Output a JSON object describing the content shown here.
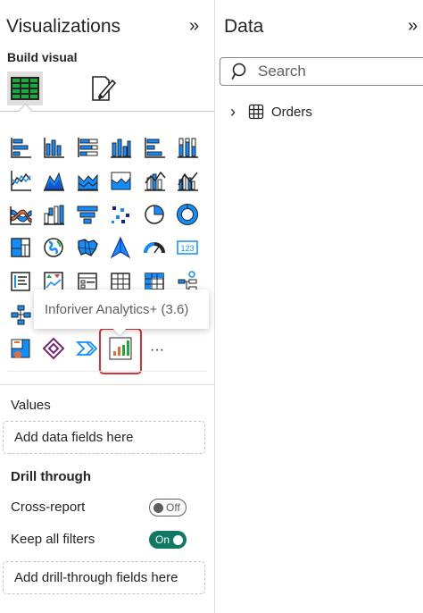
{
  "viz_pane": {
    "title": "Visualizations",
    "collapse_glyph": "»",
    "build_label": "Build visual",
    "tooltip": "Inforiver Analytics+ (3.6)",
    "more_glyph": "···",
    "values_label": "Values",
    "values_placeholder": "Add data fields here",
    "drill_through_label": "Drill through",
    "cross_report_label": "Cross-report",
    "cross_report_state": "Off",
    "keep_filters_label": "Keep all filters",
    "keep_filters_state": "On",
    "drill_placeholder": "Add drill-through fields here"
  },
  "data_pane": {
    "title": "Data",
    "collapse_glyph": "»",
    "search_placeholder": "Search",
    "tables": [
      {
        "name": "Orders",
        "expand_glyph": "›"
      }
    ]
  },
  "visual_icons": [
    [
      "stacked-bar-chart-icon",
      "clustered-bar-chart-icon",
      "100-percent-stacked-bar-chart-icon",
      "stacked-column-chart-icon",
      "clustered-column-chart-icon",
      "100-percent-stacked-column-chart-icon"
    ],
    [
      "line-chart-icon",
      "area-chart-icon",
      "stacked-area-chart-icon",
      "100-percent-stacked-area-chart-icon",
      "line-and-stacked-column-chart-icon",
      "line-and-clustered-column-chart-icon"
    ],
    [
      "ribbon-chart-icon",
      "waterfall-chart-icon",
      "funnel-chart-icon",
      "scatter-chart-icon",
      "pie-chart-icon",
      "donut-chart-icon"
    ],
    [
      "treemap-icon",
      "map-icon",
      "filled-map-icon",
      "azure-map-icon",
      "gauge-icon",
      "card-icon"
    ],
    [
      "multi-row-card-icon",
      "kpi-icon",
      "slicer-icon",
      "table-icon",
      "matrix-icon",
      "decomposition-tree-icon"
    ],
    [
      "key-influencers-icon",
      "qa-icon",
      "smart-narrative-icon",
      "paginated-report-icon",
      "power-apps-icon",
      "power-automate-icon"
    ],
    [
      "python-visual-icon",
      "powerapps-diamond-icon",
      "power-automate-arrow-icon",
      "inforiver-analytics-icon"
    ]
  ],
  "colors": {
    "accent_blue": "#118dff",
    "dark_navy": "#12239e",
    "orange": "#e66c37",
    "green": "#1aab40",
    "toggle_on": "#117865",
    "highlight_red": "#d13438"
  }
}
